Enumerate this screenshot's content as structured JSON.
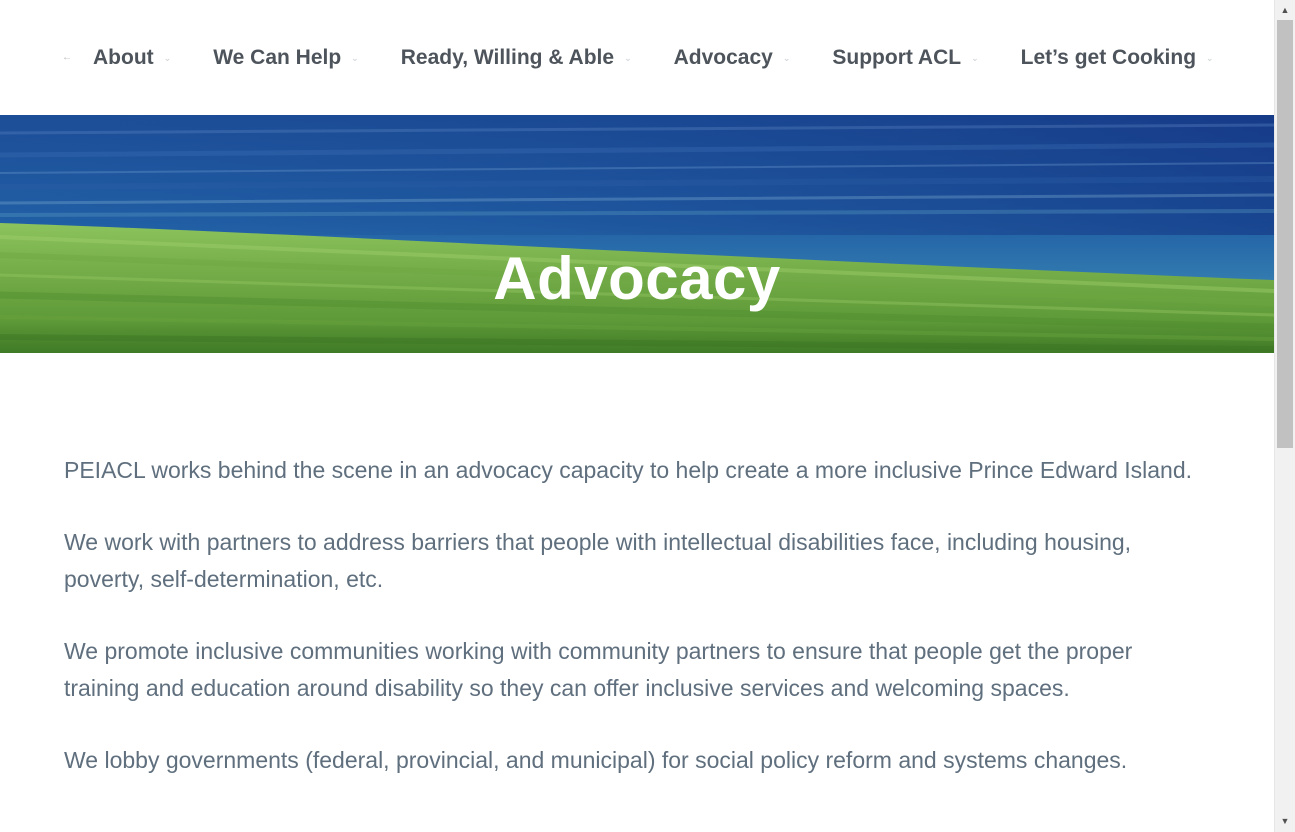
{
  "nav": {
    "prev_arrow": "←",
    "caret": "⌄",
    "items": [
      {
        "label": "About"
      },
      {
        "label": "We Can Help"
      },
      {
        "label": "Ready, Willing & Able"
      },
      {
        "label": "Advocacy"
      },
      {
        "label": "Support ACL"
      },
      {
        "label": "Let’s get Cooking"
      }
    ]
  },
  "hero": {
    "title": "Advocacy"
  },
  "article": {
    "paragraphs": [
      "PEIACL works behind the scene in an advocacy capacity to help create a more inclusive Prince Edward Island.",
      "We work with partners to address barriers that people with intellectual disabilities face, including housing, poverty, self-determination, etc.",
      "We promote inclusive communities working with community partners to ensure that people get the proper training and education around disability so they can offer inclusive services and welcoming spaces.",
      "We lobby governments (federal, provincial, and municipal) for social policy reform and systems changes."
    ]
  },
  "scrollbar": {
    "up_arrow": "▲",
    "down_arrow": "▼",
    "position_fraction": 0.0
  },
  "colors": {
    "nav_text": "#4e545b",
    "body_text": "#5f6f7e",
    "hero_sky": "#1f4f9a",
    "hero_field": "#5f9b3a",
    "hero_title": "#ffffff"
  },
  "icons": {
    "nav_prev": "left-arrow-icon",
    "nav_caret": "chevron-down-icon",
    "scroll_up": "triangle-up-icon",
    "scroll_down": "triangle-down-icon"
  }
}
